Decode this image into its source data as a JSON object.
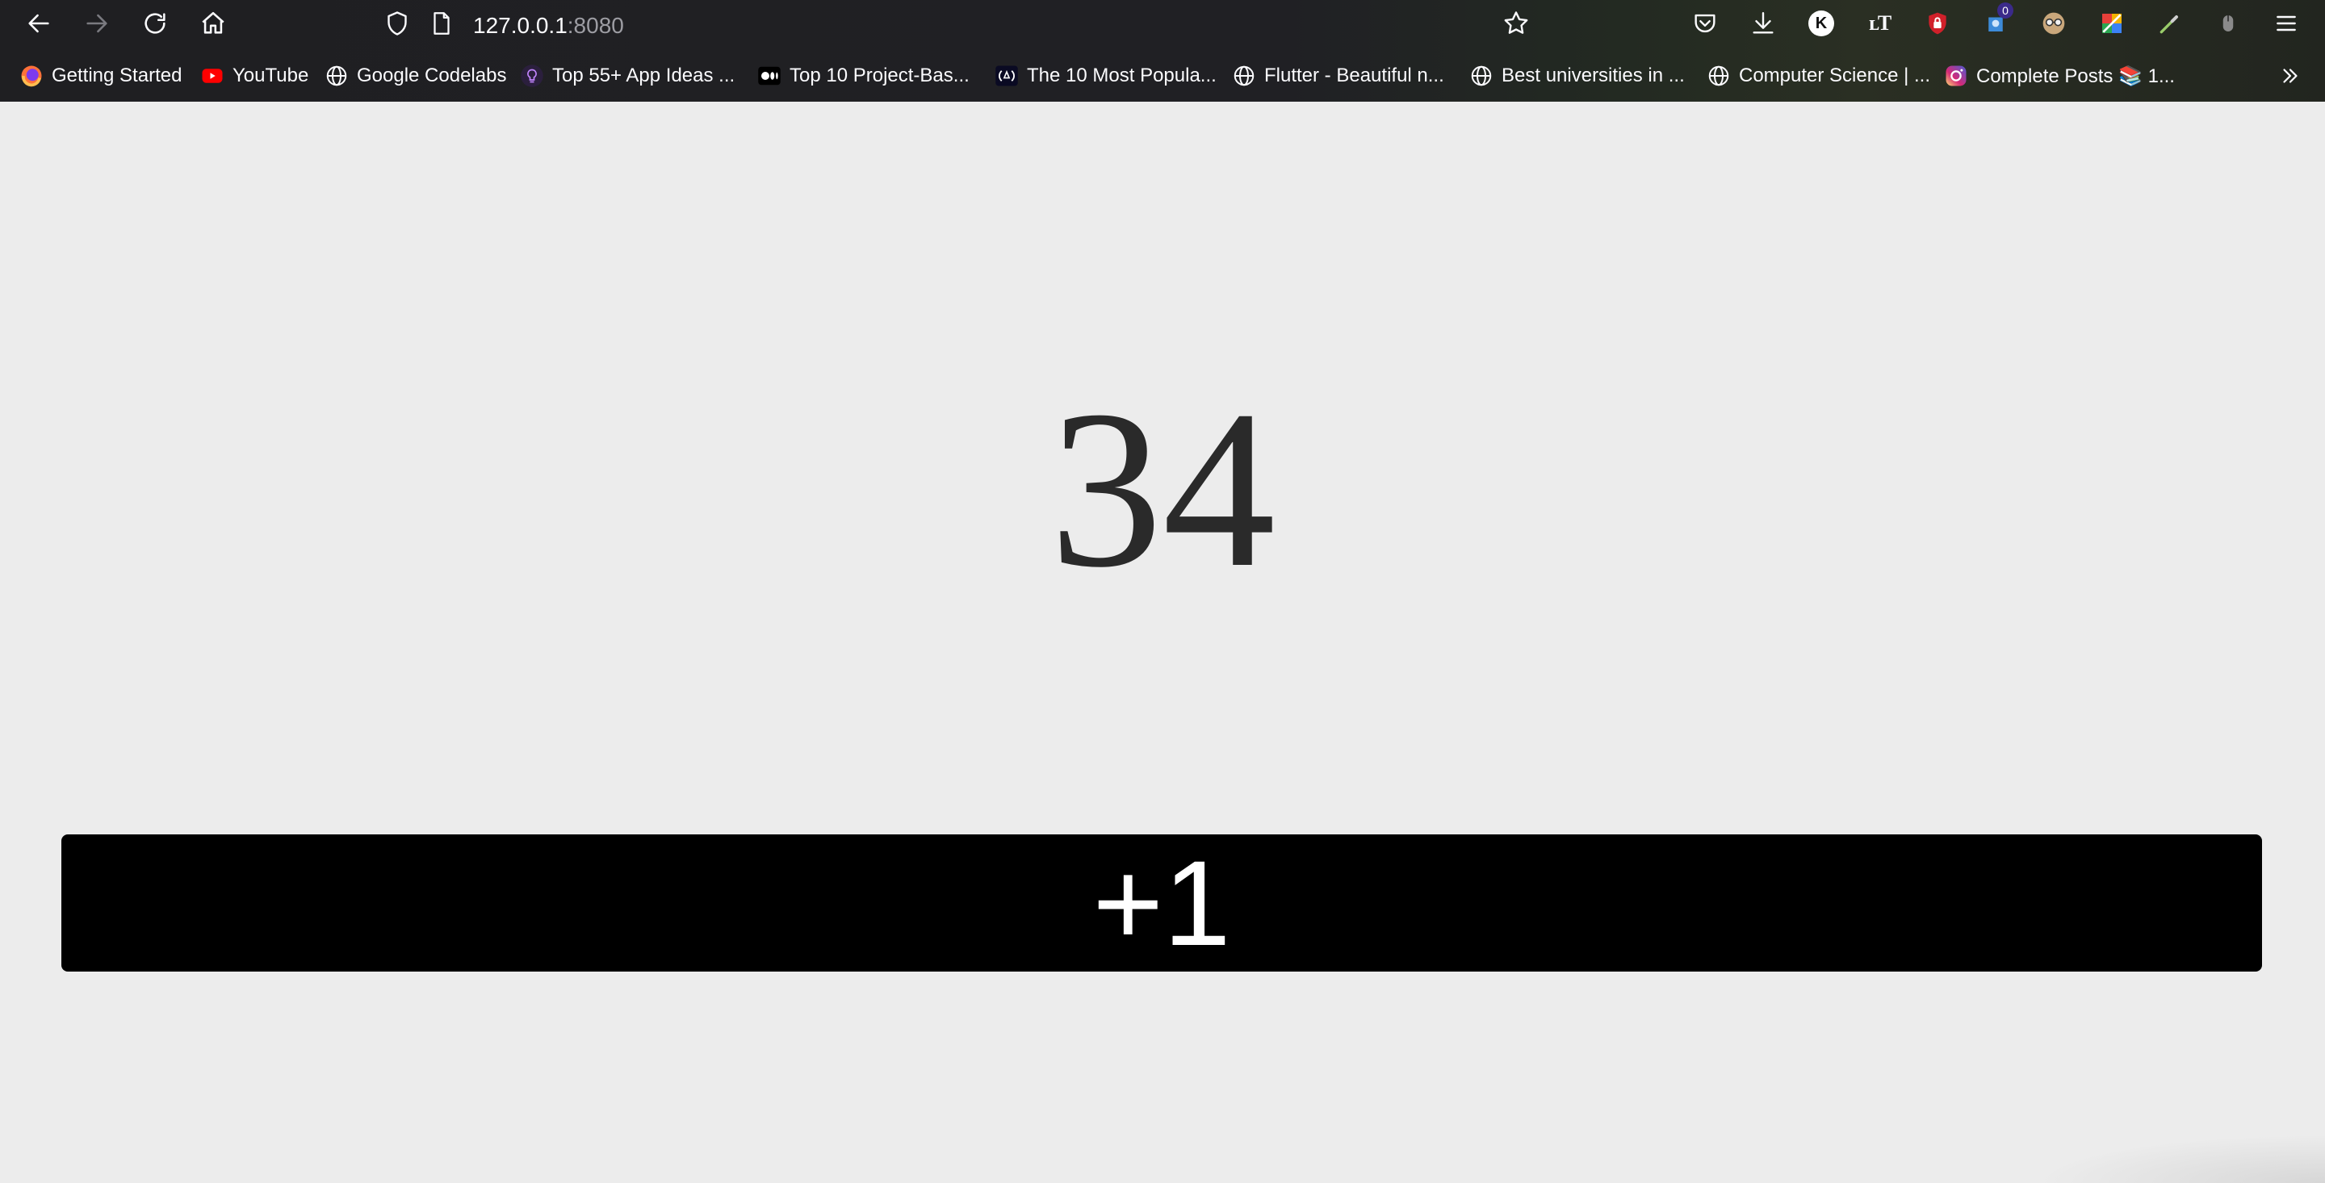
{
  "browser": {
    "url_host": "127.0.0.1",
    "url_port": ":8080",
    "notification_badge": "0",
    "profile_initial": "K"
  },
  "bookmarks": [
    {
      "label": "Getting Started",
      "icon": "firefox-icon"
    },
    {
      "label": "YouTube",
      "icon": "youtube-icon"
    },
    {
      "label": "Google Codelabs",
      "icon": "globe-icon"
    },
    {
      "label": "Top 55+ App Ideas ...",
      "icon": "lightbulb-icon"
    },
    {
      "label": "Top 10 Project-Bas...",
      "icon": "medium-icon"
    },
    {
      "label": "The 10 Most Popula...",
      "icon": "freecodecamp-icon"
    },
    {
      "label": "Flutter - Beautiful n...",
      "icon": "globe-icon"
    },
    {
      "label": "Best universities in ...",
      "icon": "globe-icon"
    },
    {
      "label": "Computer Science | ...",
      "icon": "globe-icon"
    },
    {
      "label": "Complete Posts 📚 1...",
      "icon": "instagram-icon"
    }
  ],
  "app": {
    "counter_value": "34",
    "increment_label": "+1"
  },
  "colors": {
    "page_background": "#ececec",
    "button_background": "#000000",
    "button_text": "#ffffff",
    "counter_text": "#2a2a2a"
  }
}
